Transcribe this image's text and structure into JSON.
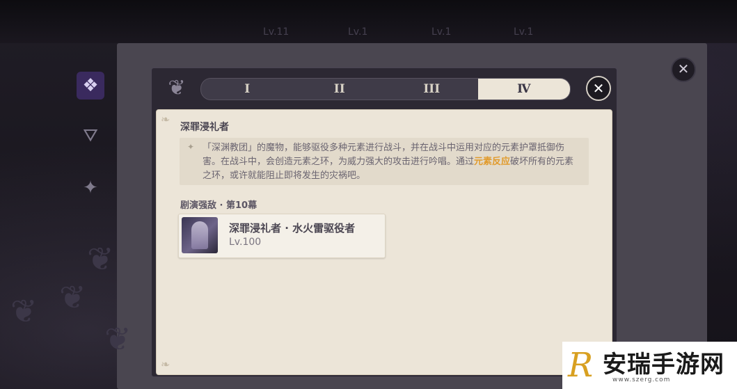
{
  "background": {
    "top_bar": {
      "items": [
        "Lv.11",
        "Lv.1",
        "Lv.1",
        "Lv.1"
      ]
    },
    "close_glyph": "✕",
    "rail_icons": [
      "poster-icon",
      "hat-icon",
      "card-icon"
    ]
  },
  "dialog": {
    "tabs": [
      {
        "label": "I",
        "active": false
      },
      {
        "label": "II",
        "active": false
      },
      {
        "label": "III",
        "active": false
      },
      {
        "label": "Ⅳ",
        "active": true
      }
    ],
    "close_glyph": "✕",
    "title": "深罪浸礼者",
    "description": {
      "before": "「深渊教团」的魔物，能够驱役多种元素进行战斗，并在战斗中运用对应的元素护罩抵御伤害。在战斗中，会创造元素之环，为威力强大的攻击进行吟唱。通过",
      "highlight": "元素反应",
      "after": "破坏所有的元素之环，或许就能阻止即将发生的灾祸吧。"
    },
    "section_label": "剧演强敌 · 第10幕",
    "enemy": {
      "name": "深罪浸礼者 · 水火雷驱役者",
      "level": "Lv.100"
    }
  },
  "watermark": {
    "logo": "R",
    "text": "安瑞手游网",
    "url": "www.szerg.com"
  },
  "colors": {
    "highlight": "#e19b2d",
    "panel": "#ece5d8",
    "dark": "#2c2833"
  }
}
